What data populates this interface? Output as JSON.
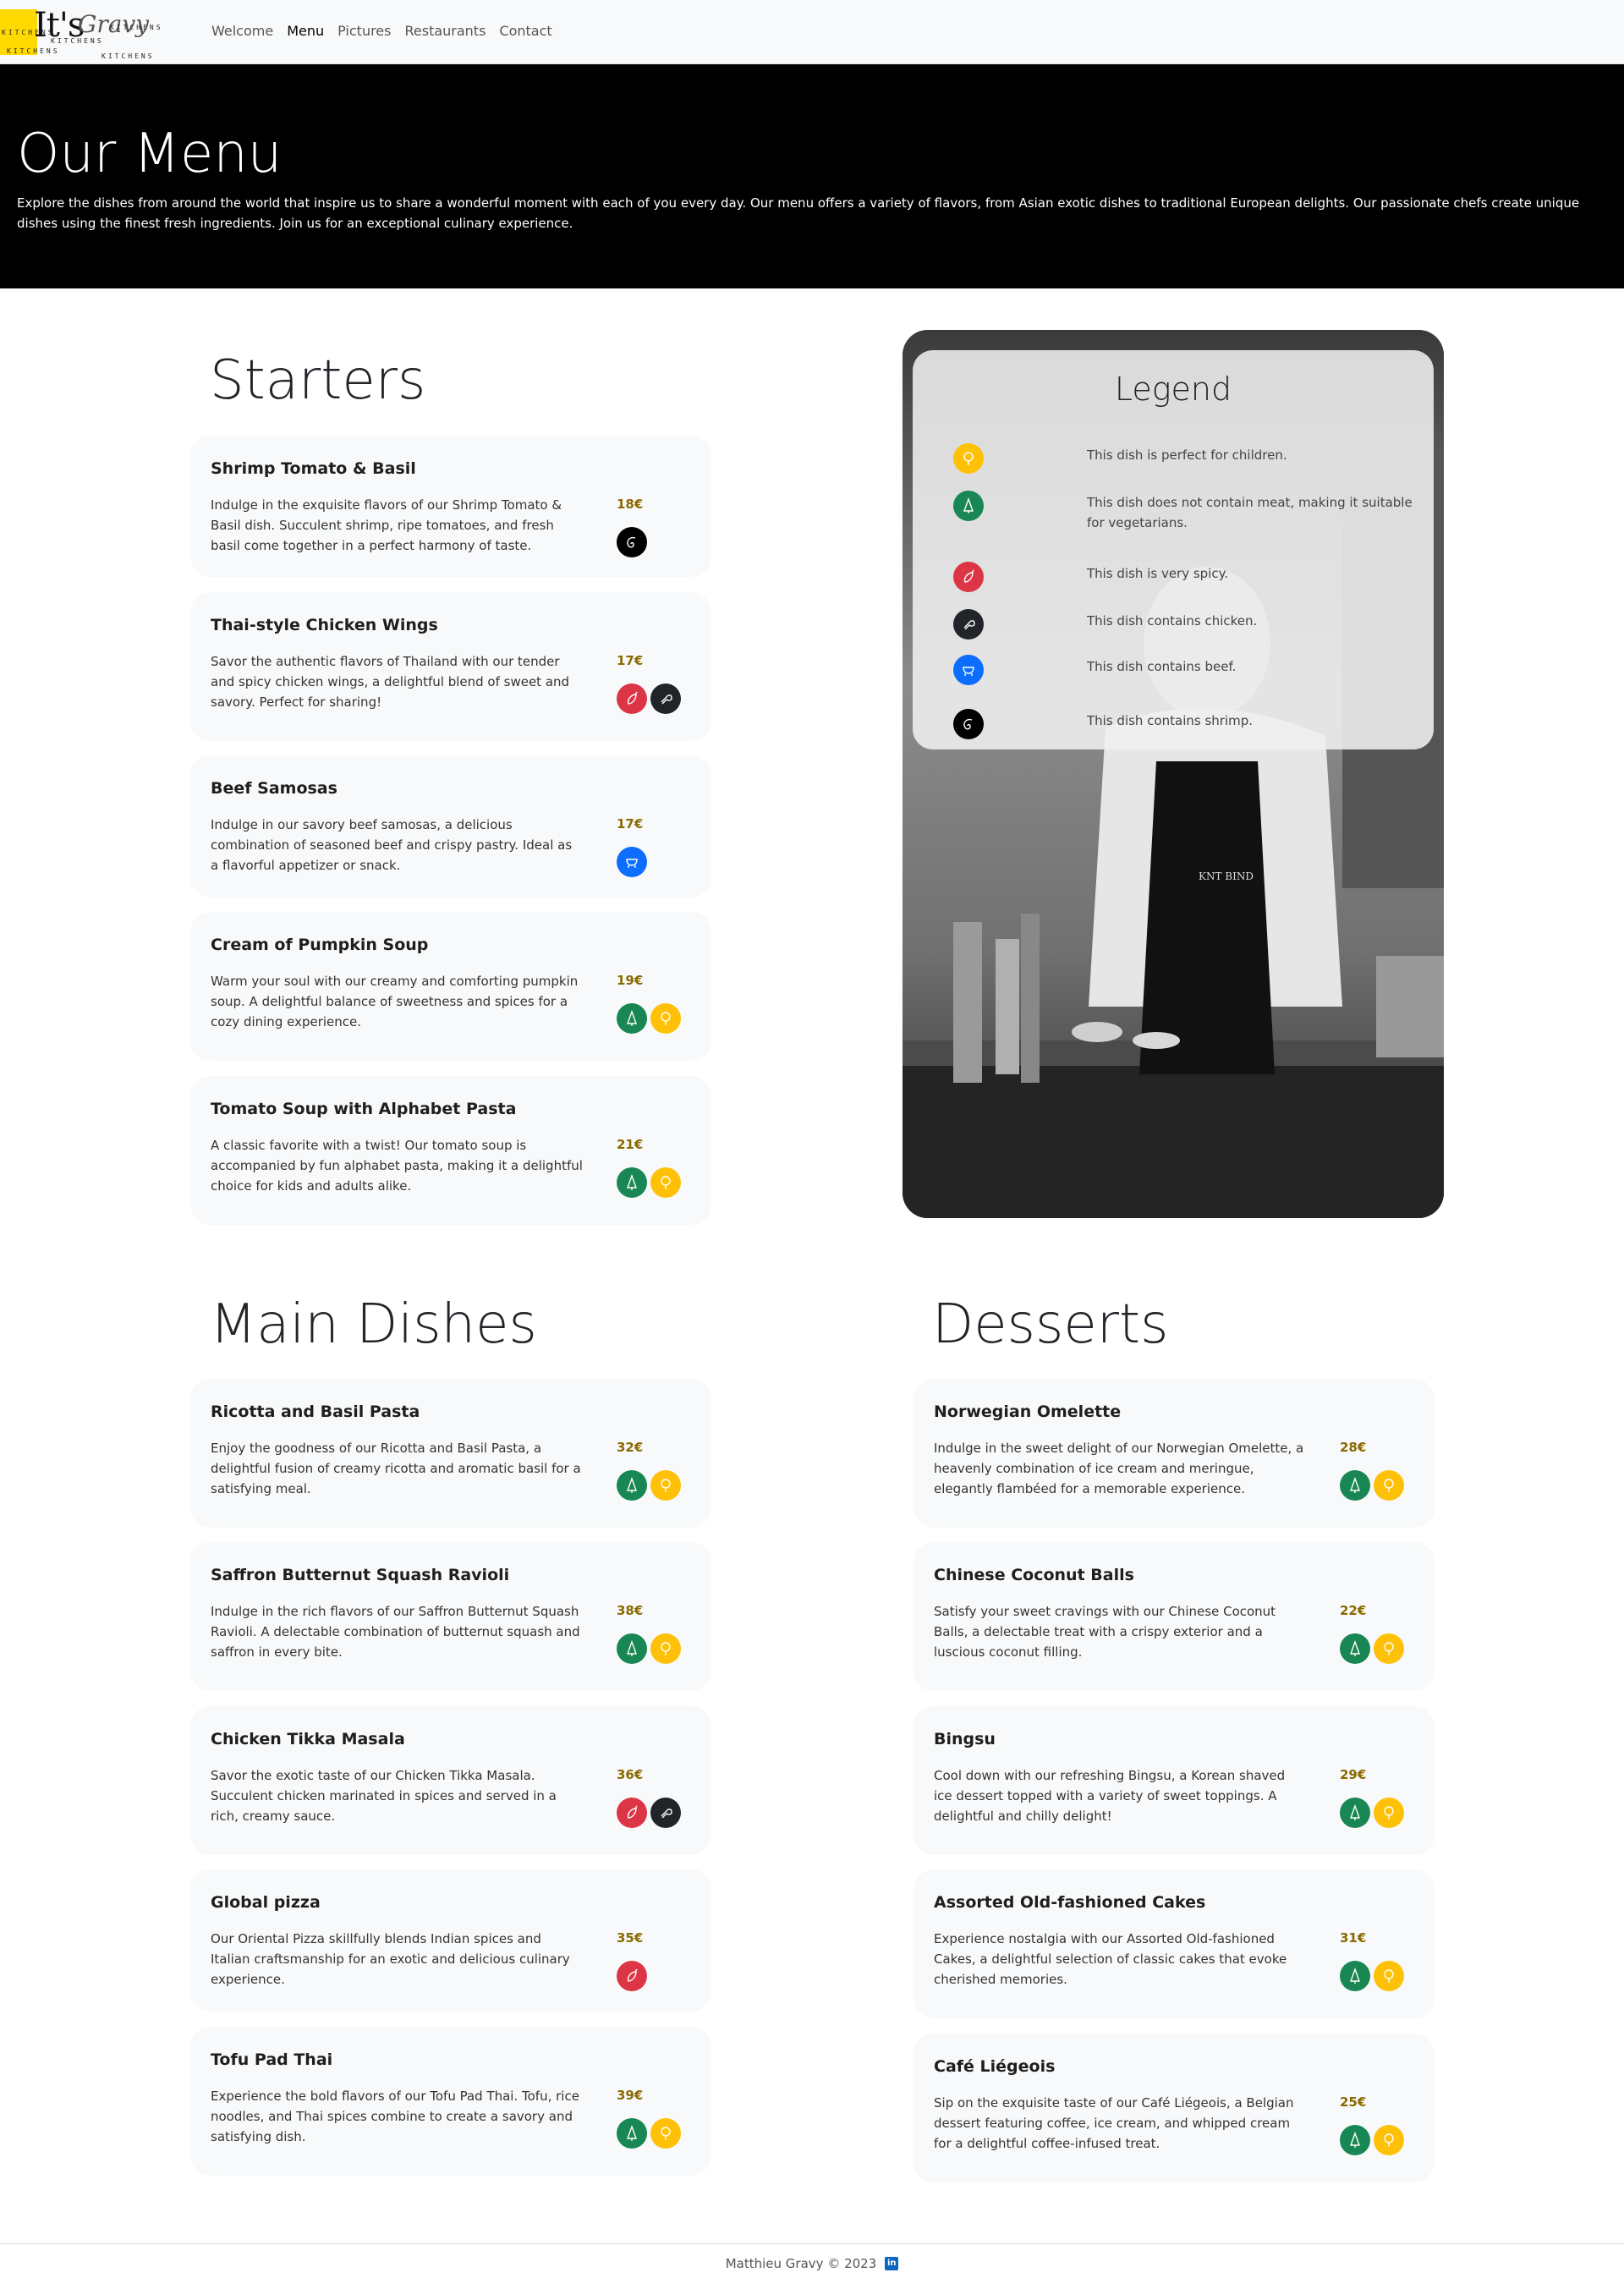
{
  "nav": {
    "logo": {
      "main": "It's",
      "script": "Gravy",
      "small": "KITCHENS"
    },
    "links": [
      {
        "label": "Welcome",
        "active": false
      },
      {
        "label": "Menu",
        "active": true
      },
      {
        "label": "Pictures",
        "active": false
      },
      {
        "label": "Restaurants",
        "active": false
      },
      {
        "label": "Contact",
        "active": false
      }
    ]
  },
  "hero": {
    "title": "Our Menu",
    "text": "Explore the dishes from around the world that inspire us to share a wonderful moment with each of you every day. Our menu offers a variety of flavors, from Asian exotic dishes to traditional European delights. Our passionate chefs create unique dishes using the finest fresh ingredients. Join us for an exceptional culinary experience."
  },
  "starters": {
    "title": "Starters",
    "items": [
      {
        "name": "Shrimp Tomato & Basil",
        "desc": "Indulge in the exquisite flavors of our Shrimp Tomato & Basil dish. Succulent shrimp, ripe tomatoes, and fresh basil come together in a perfect harmony of taste.",
        "price": "18€",
        "icons": [
          "shrimp"
        ]
      },
      {
        "name": "Thai-style Chicken Wings",
        "desc": "Savor the authentic flavors of Thailand with our tender and spicy chicken wings, a delightful blend of sweet and savory. Perfect for sharing!",
        "price": "17€",
        "icons": [
          "spicy",
          "chicken"
        ]
      },
      {
        "name": "Beef Samosas",
        "desc": "Indulge in our savory beef samosas, a delicious combination of seasoned beef and crispy pastry. Ideal as a flavorful appetizer or snack.",
        "price": "17€",
        "icons": [
          "beef"
        ]
      },
      {
        "name": "Cream of Pumpkin Soup",
        "desc": "Warm your soul with our creamy and comforting pumpkin soup. A delightful balance of sweetness and spices for a cozy dining experience.",
        "price": "19€",
        "icons": [
          "veg",
          "kids"
        ]
      },
      {
        "name": "Tomato Soup with Alphabet Pasta",
        "desc": "A classic favorite with a twist! Our tomato soup is accompanied by fun alphabet pasta, making it a delightful choice for kids and adults alike.",
        "price": "21€",
        "icons": [
          "veg",
          "kids"
        ]
      }
    ]
  },
  "legend": {
    "title": "Legend",
    "items": [
      {
        "icon": "kids",
        "text": "This dish is perfect for children."
      },
      {
        "icon": "veg",
        "text": "This dish does not contain meat, making it suitable for vegetarians."
      },
      {
        "icon": "spicy",
        "text": "This dish is very spicy."
      },
      {
        "icon": "chicken",
        "text": "This dish contains chicken."
      },
      {
        "icon": "beef",
        "text": "This dish contains beef."
      },
      {
        "icon": "shrimp",
        "text": "This dish contains shrimp."
      }
    ],
    "photo_apron_text": "KNT BIND"
  },
  "mains": {
    "title": "Main Dishes",
    "items": [
      {
        "name": "Ricotta and Basil Pasta",
        "desc": "Enjoy the goodness of our Ricotta and Basil Pasta, a delightful fusion of creamy ricotta and aromatic basil for a satisfying meal.",
        "price": "32€",
        "icons": [
          "veg",
          "kids"
        ]
      },
      {
        "name": "Saffron Butternut Squash Ravioli",
        "desc": "Indulge in the rich flavors of our Saffron Butternut Squash Ravioli. A delectable combination of butternut squash and saffron in every bite.",
        "price": "38€",
        "icons": [
          "veg",
          "kids"
        ]
      },
      {
        "name": "Chicken Tikka Masala",
        "desc": "Savor the exotic taste of our Chicken Tikka Masala. Succulent chicken marinated in spices and served in a rich, creamy sauce.",
        "price": "36€",
        "icons": [
          "spicy",
          "chicken"
        ]
      },
      {
        "name": "Global pizza",
        "desc": "Our Oriental Pizza skillfully blends Indian spices and Italian craftsmanship for an exotic and delicious culinary experience.",
        "price": "35€",
        "icons": [
          "spicy"
        ]
      },
      {
        "name": "Tofu Pad Thai",
        "desc": "Experience the bold flavors of our Tofu Pad Thai. Tofu, rice noodles, and Thai spices combine to create a savory and satisfying dish.",
        "price": "39€",
        "icons": [
          "veg",
          "kids"
        ]
      }
    ]
  },
  "desserts": {
    "title": "Desserts",
    "items": [
      {
        "name": "Norwegian Omelette",
        "desc": "Indulge in the sweet delight of our Norwegian Omelette, a heavenly combination of ice cream and meringue, elegantly flambéed for a memorable experience.",
        "price": "28€",
        "icons": [
          "veg",
          "kids"
        ]
      },
      {
        "name": "Chinese Coconut Balls",
        "desc": "Satisfy your sweet cravings with our Chinese Coconut Balls, a delectable treat with a crispy exterior and a luscious coconut filling.",
        "price": "22€",
        "icons": [
          "veg",
          "kids"
        ]
      },
      {
        "name": "Bingsu",
        "desc": "Cool down with our refreshing Bingsu, a Korean shaved ice dessert topped with a variety of sweet toppings. A delightful and chilly delight!",
        "price": "29€",
        "icons": [
          "veg",
          "kids"
        ]
      },
      {
        "name": "Assorted Old-fashioned Cakes",
        "desc": "Experience nostalgia with our Assorted Old-fashioned Cakes, a delightful selection of classic cakes that evoke cherished memories.",
        "price": "31€",
        "icons": [
          "veg",
          "kids"
        ]
      },
      {
        "name": "Café Liégeois",
        "desc": "Sip on the exquisite taste of our Café Liégeois, a Belgian dessert featuring coffee, ice cream, and whipped cream for a delightful coffee-infused treat.",
        "price": "25€",
        "icons": [
          "veg",
          "kids"
        ]
      }
    ]
  },
  "footer": {
    "text": "Matthieu Gravy © 2023",
    "social_icon": "linkedin-icon"
  },
  "colors": {
    "kids": "#ffc107",
    "veg": "#198754",
    "spicy": "#dc3545",
    "chicken": "#212529",
    "beef": "#0d6efd",
    "shrimp": "#000000",
    "price": "#8a6a00",
    "hero_bg": "#000000",
    "card_bg": "#f8f9fa"
  }
}
